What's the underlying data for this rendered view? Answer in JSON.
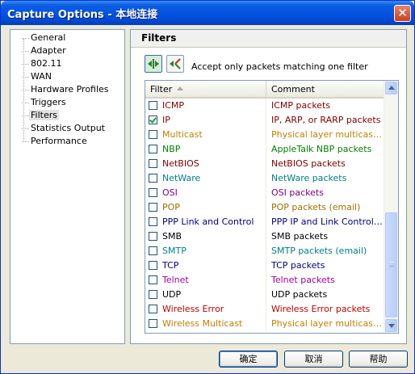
{
  "window": {
    "title": "Capture Options - 本地连接",
    "close_label": "✕"
  },
  "nav": {
    "items": [
      {
        "label": "General"
      },
      {
        "label": "Adapter"
      },
      {
        "label": "802.11"
      },
      {
        "label": "WAN"
      },
      {
        "label": "Hardware Profiles"
      },
      {
        "label": "Triggers"
      },
      {
        "label": "Filters",
        "selected": true
      },
      {
        "label": "Statistics Output"
      },
      {
        "label": "Performance"
      }
    ]
  },
  "filters_panel": {
    "heading": "Filters",
    "mode_caption": "Accept only packets matching one filter",
    "columns": {
      "filter": "Filter",
      "comment": "Comment"
    },
    "rows": [
      {
        "name": "ICMP",
        "comment": "ICMP packets",
        "checked": false,
        "color": "#800000"
      },
      {
        "name": "IP",
        "comment": "IP, ARP, or RARP packets",
        "checked": true,
        "color": "#800000"
      },
      {
        "name": "Multicast",
        "comment": "Physical layer multicast e...",
        "checked": false,
        "color": "#c08000"
      },
      {
        "name": "NBP",
        "comment": "AppleTalk NBP packets",
        "checked": false,
        "color": "#008000"
      },
      {
        "name": "NetBIOS",
        "comment": "NetBIOS packets",
        "checked": false,
        "color": "#800000"
      },
      {
        "name": "NetWare",
        "comment": "NetWare packets",
        "checked": false,
        "color": "#008080"
      },
      {
        "name": "OSI",
        "comment": "OSI packets",
        "checked": false,
        "color": "#800080"
      },
      {
        "name": "POP",
        "comment": "POP packets (email)",
        "checked": false,
        "color": "#a07000"
      },
      {
        "name": "PPP Link and Control",
        "comment": "PPP IP and Link Control p...",
        "checked": false,
        "color": "#000080"
      },
      {
        "name": "SMB",
        "comment": "SMB packets",
        "checked": false,
        "color": "#000000"
      },
      {
        "name": "SMTP",
        "comment": "SMTP packets (email)",
        "checked": false,
        "color": "#008080"
      },
      {
        "name": "TCP",
        "comment": "TCP packets",
        "checked": false,
        "color": "#000080"
      },
      {
        "name": "Telnet",
        "comment": "Telnet packets",
        "checked": false,
        "color": "#a000a0"
      },
      {
        "name": "UDP",
        "comment": "UDP packets",
        "checked": false,
        "color": "#000000"
      },
      {
        "name": "Wireless Error",
        "comment": "Wireless Error packets",
        "checked": false,
        "color": "#c00000"
      },
      {
        "name": "Wireless Multicast",
        "comment": "Physical layer multicast w...",
        "checked": false,
        "color": "#c08000"
      }
    ]
  },
  "buttons": {
    "ok": "确定",
    "cancel": "取消",
    "help": "帮助"
  }
}
